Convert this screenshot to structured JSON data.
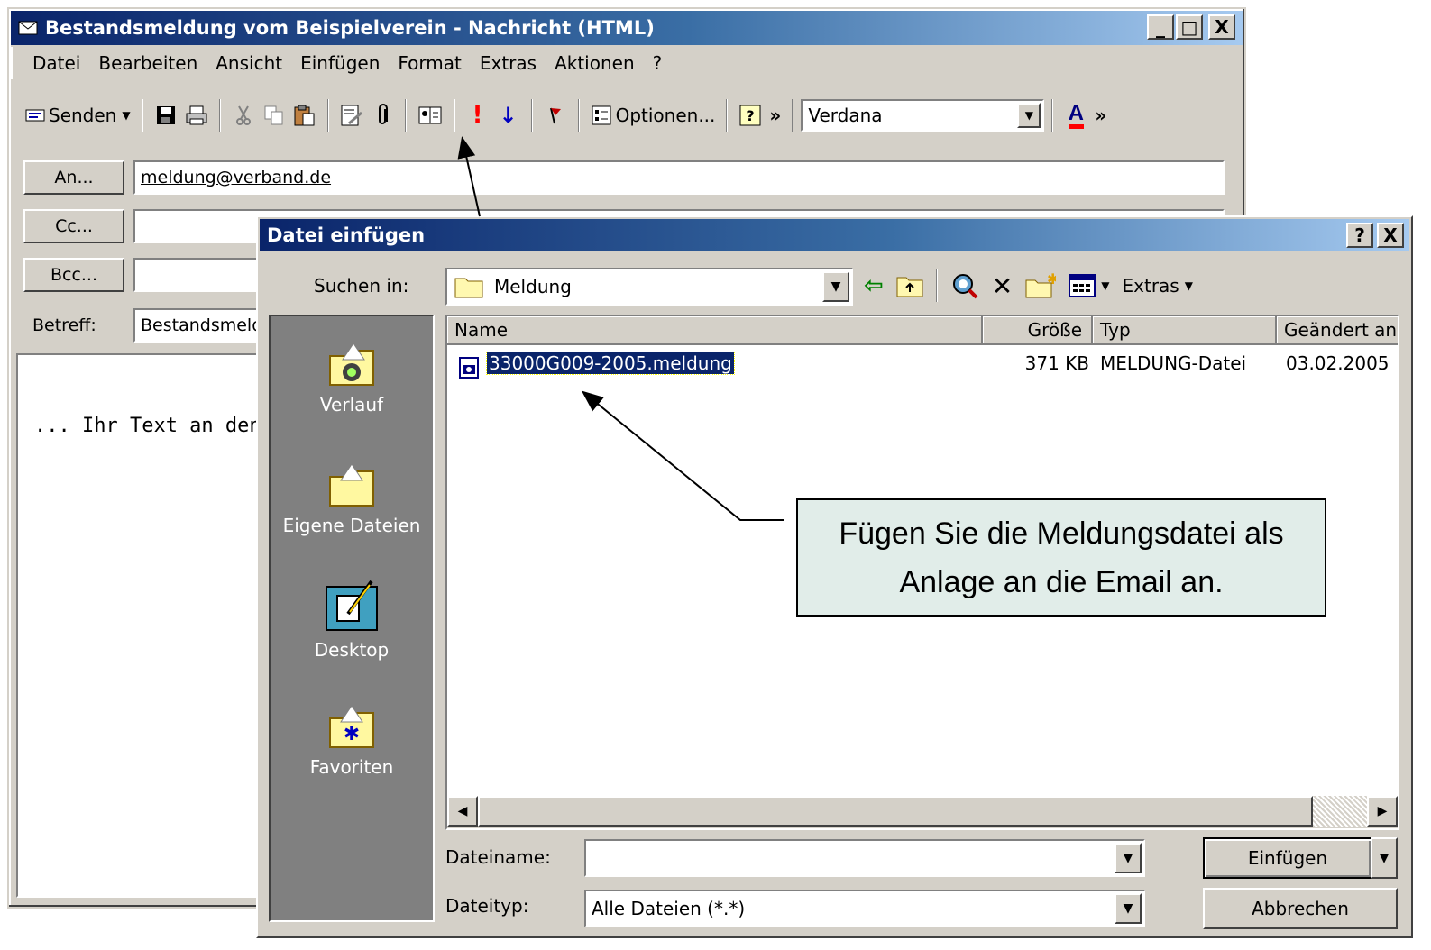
{
  "mail": {
    "title": "Bestandsmeldung vom Beispielverein - Nachricht (HTML)",
    "title_buttons": [
      "_",
      "□",
      "X"
    ],
    "menu": [
      "Datei",
      "Bearbeiten",
      "Ansicht",
      "Einfügen",
      "Format",
      "Extras",
      "Aktionen",
      "?"
    ],
    "toolbar": {
      "send_label": "Senden",
      "options_label": "Optionen...",
      "font_value": "Verdana",
      "more_glyph": "»"
    },
    "fields": {
      "to_label": "An...",
      "to_value": "meldung@verband.de",
      "cc_label": "Cc...",
      "bcc_label": "Bcc...",
      "subject_label": "Betreff:",
      "subject_value": "Bestandsmeld"
    },
    "body_text": "... Ihr Text an den"
  },
  "dialog": {
    "title": "Datei einfügen",
    "help_glyph": "?",
    "close_glyph": "X",
    "look_in_label": "Suchen in:",
    "look_in_value": "Meldung",
    "extras_label": "Extras",
    "places": [
      "Verlauf",
      "Eigene Dateien",
      "Desktop",
      "Favoriten"
    ],
    "columns": [
      "Name",
      "Größe",
      "Typ",
      "Geändert an"
    ],
    "files": [
      {
        "name": "33000G009-2005.meldung",
        "size": "371 KB",
        "type": "MELDUNG-Datei",
        "modified": "03.02.2005"
      }
    ],
    "filename_label": "Dateiname:",
    "filename_value": "",
    "filetype_label": "Dateityp:",
    "filetype_value": "Alle Dateien (*.*)",
    "insert_button": "Einfügen",
    "cancel_button": "Abbrechen"
  },
  "callout": {
    "line1": "Fügen Sie die Meldungsdatei als",
    "line2": "Anlage an die Email an."
  },
  "colors": {
    "title_start": "#0a246a",
    "title_end": "#a6caf0",
    "face": "#d4d0c8",
    "selection": "#0a246a",
    "callout_bg": "#e1ede9"
  }
}
